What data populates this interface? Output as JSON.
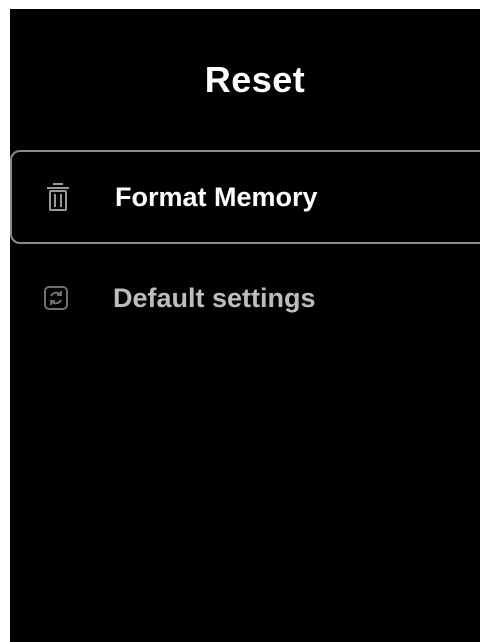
{
  "screen": {
    "title": "Reset"
  },
  "menu": {
    "items": [
      {
        "label": "Format Memory",
        "icon": "trash-icon",
        "selected": true
      },
      {
        "label": "Default settings",
        "icon": "refresh-icon",
        "selected": false
      }
    ]
  },
  "colors": {
    "background": "#000000",
    "text": "#ffffff",
    "dim_text": "#bdbdbd",
    "selection_border": "#8a8a8a"
  }
}
